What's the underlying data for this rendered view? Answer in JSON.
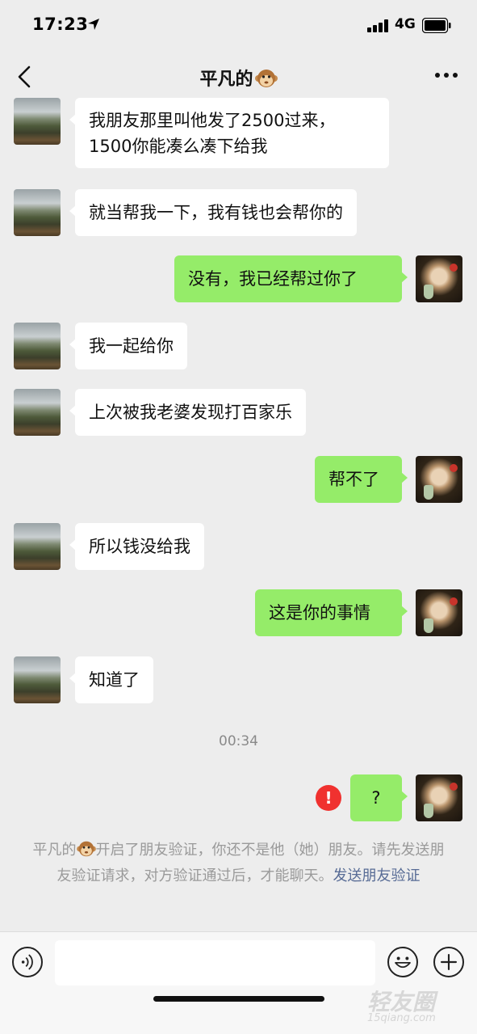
{
  "status_bar": {
    "time": "17:23",
    "network": "4G"
  },
  "header": {
    "title": "平凡的"
  },
  "messages": [
    {
      "side": "left",
      "text": "我朋友那里叫他发了2500过来，\n1500你能凑么凑下给我"
    },
    {
      "side": "left",
      "text": "就当帮我一下，我有钱也会帮你的"
    },
    {
      "side": "right",
      "text": "没有，我已经帮过你了"
    },
    {
      "side": "left",
      "text": "我一起给你"
    },
    {
      "side": "left",
      "text": "上次被我老婆发现打百家乐"
    },
    {
      "side": "right",
      "text": "帮不了"
    },
    {
      "side": "left",
      "text": "所以钱没给我"
    },
    {
      "side": "right",
      "text": "这是你的事情"
    },
    {
      "side": "left",
      "text": "知道了"
    },
    {
      "side": "right",
      "text": "?",
      "failed": true
    }
  ],
  "timestamp": "00:34",
  "error_mark": "!",
  "notice": {
    "text_before": "平凡的",
    "text_after": "开启了朋友验证，你还不是他（她）朋友。请先发送朋友验证请求，对方验证通过后，才能聊天。",
    "link": "发送朋友验证"
  },
  "watermark": {
    "main": "轻友圈",
    "sub": "15qiang.com"
  },
  "colors": {
    "background": "#ededed",
    "bubble_sent": "#95ec69",
    "bubble_received": "#ffffff",
    "link": "#576b95",
    "error": "#f0312f"
  },
  "icons": [
    "location-arrow-icon",
    "signal-icon",
    "battery-icon",
    "back-icon",
    "monkey-emoji-icon",
    "more-icon",
    "error-icon",
    "voice-icon",
    "emoji-icon",
    "plus-icon"
  ]
}
